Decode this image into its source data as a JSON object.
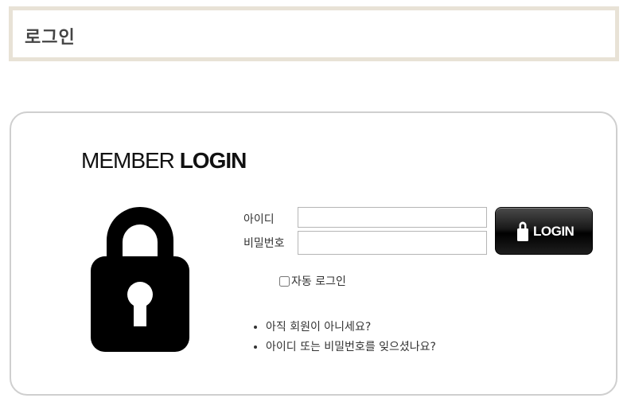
{
  "header": {
    "title": "로그인"
  },
  "login": {
    "title_light": "MEMBER",
    "title_bold": "LOGIN",
    "id_label": "아이디",
    "id_value": "",
    "password_label": "비밀번호",
    "password_value": "",
    "button_label": "LOGIN",
    "auto_login_label": "자동 로그인",
    "auto_login_checked": false,
    "links": [
      "아직 회원이 아니세요?",
      "아이디 또는 비밀번호를 잊으셨나요?"
    ]
  },
  "icons": {
    "big_lock": "lock-icon",
    "button_lock": "lock-icon"
  },
  "colors": {
    "header_border": "#e8e2d6",
    "box_border": "#cfcfcf",
    "button_bg": "#000000",
    "text": "#333333"
  }
}
